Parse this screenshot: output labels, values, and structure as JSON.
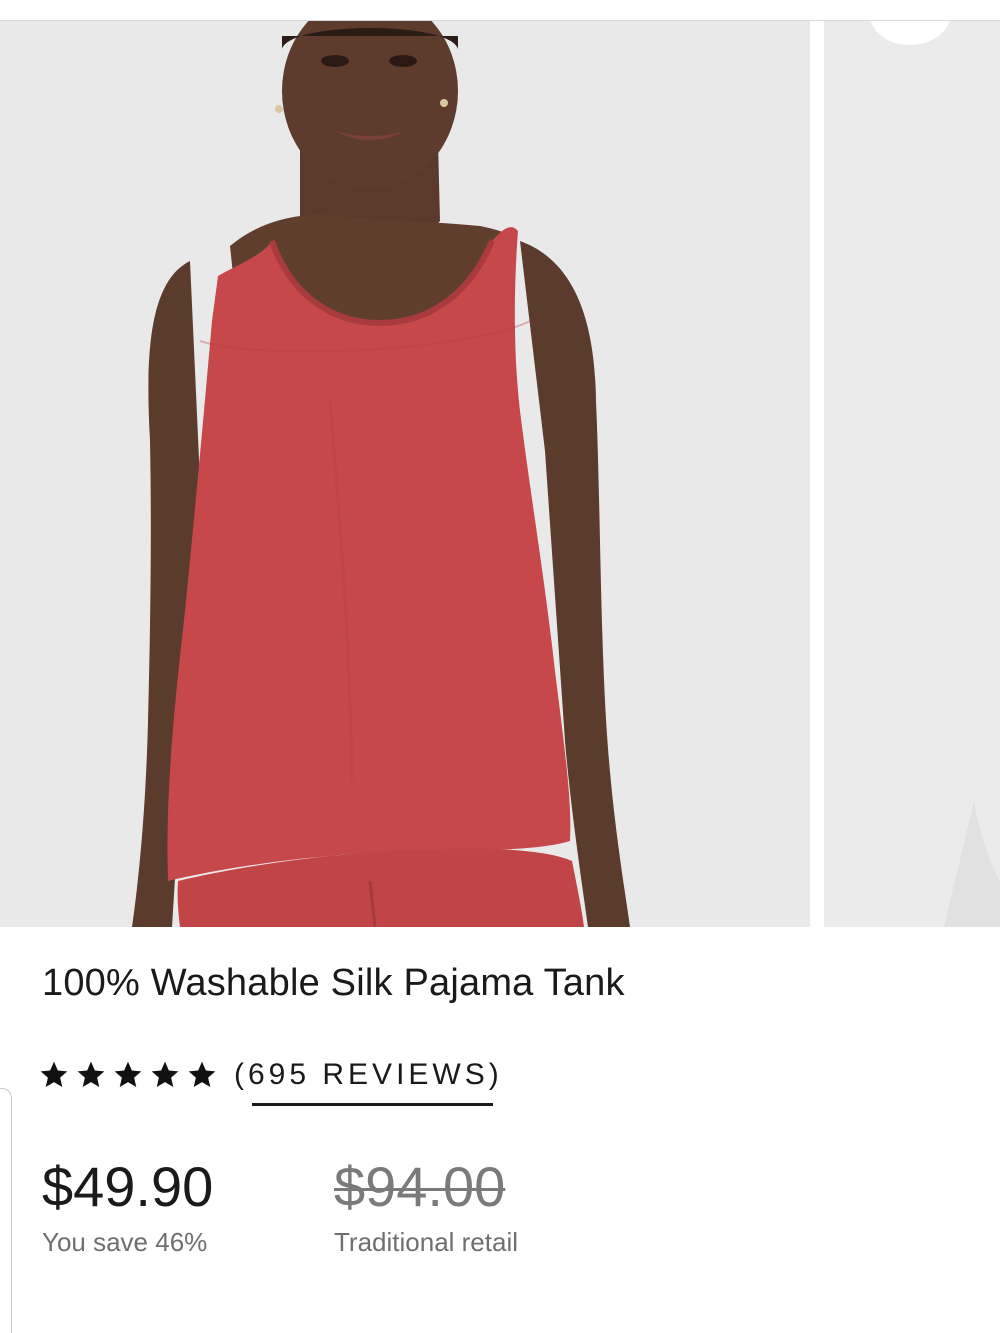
{
  "product": {
    "title": "100% Washable Silk Pajama Tank",
    "rating": 5,
    "reviews_label": "(695 REVIEWS)"
  },
  "pricing": {
    "current_price": "$49.90",
    "savings_text": "You save 46%",
    "retail_price": "$94.00",
    "retail_label": "Traditional retail"
  },
  "colors": {
    "tank_red": "#c6484b",
    "photo_background": "#eae9ea",
    "text": "#1a1a1a",
    "muted_text": "#6f6f6f"
  },
  "icons": {
    "star": "star-icon"
  }
}
